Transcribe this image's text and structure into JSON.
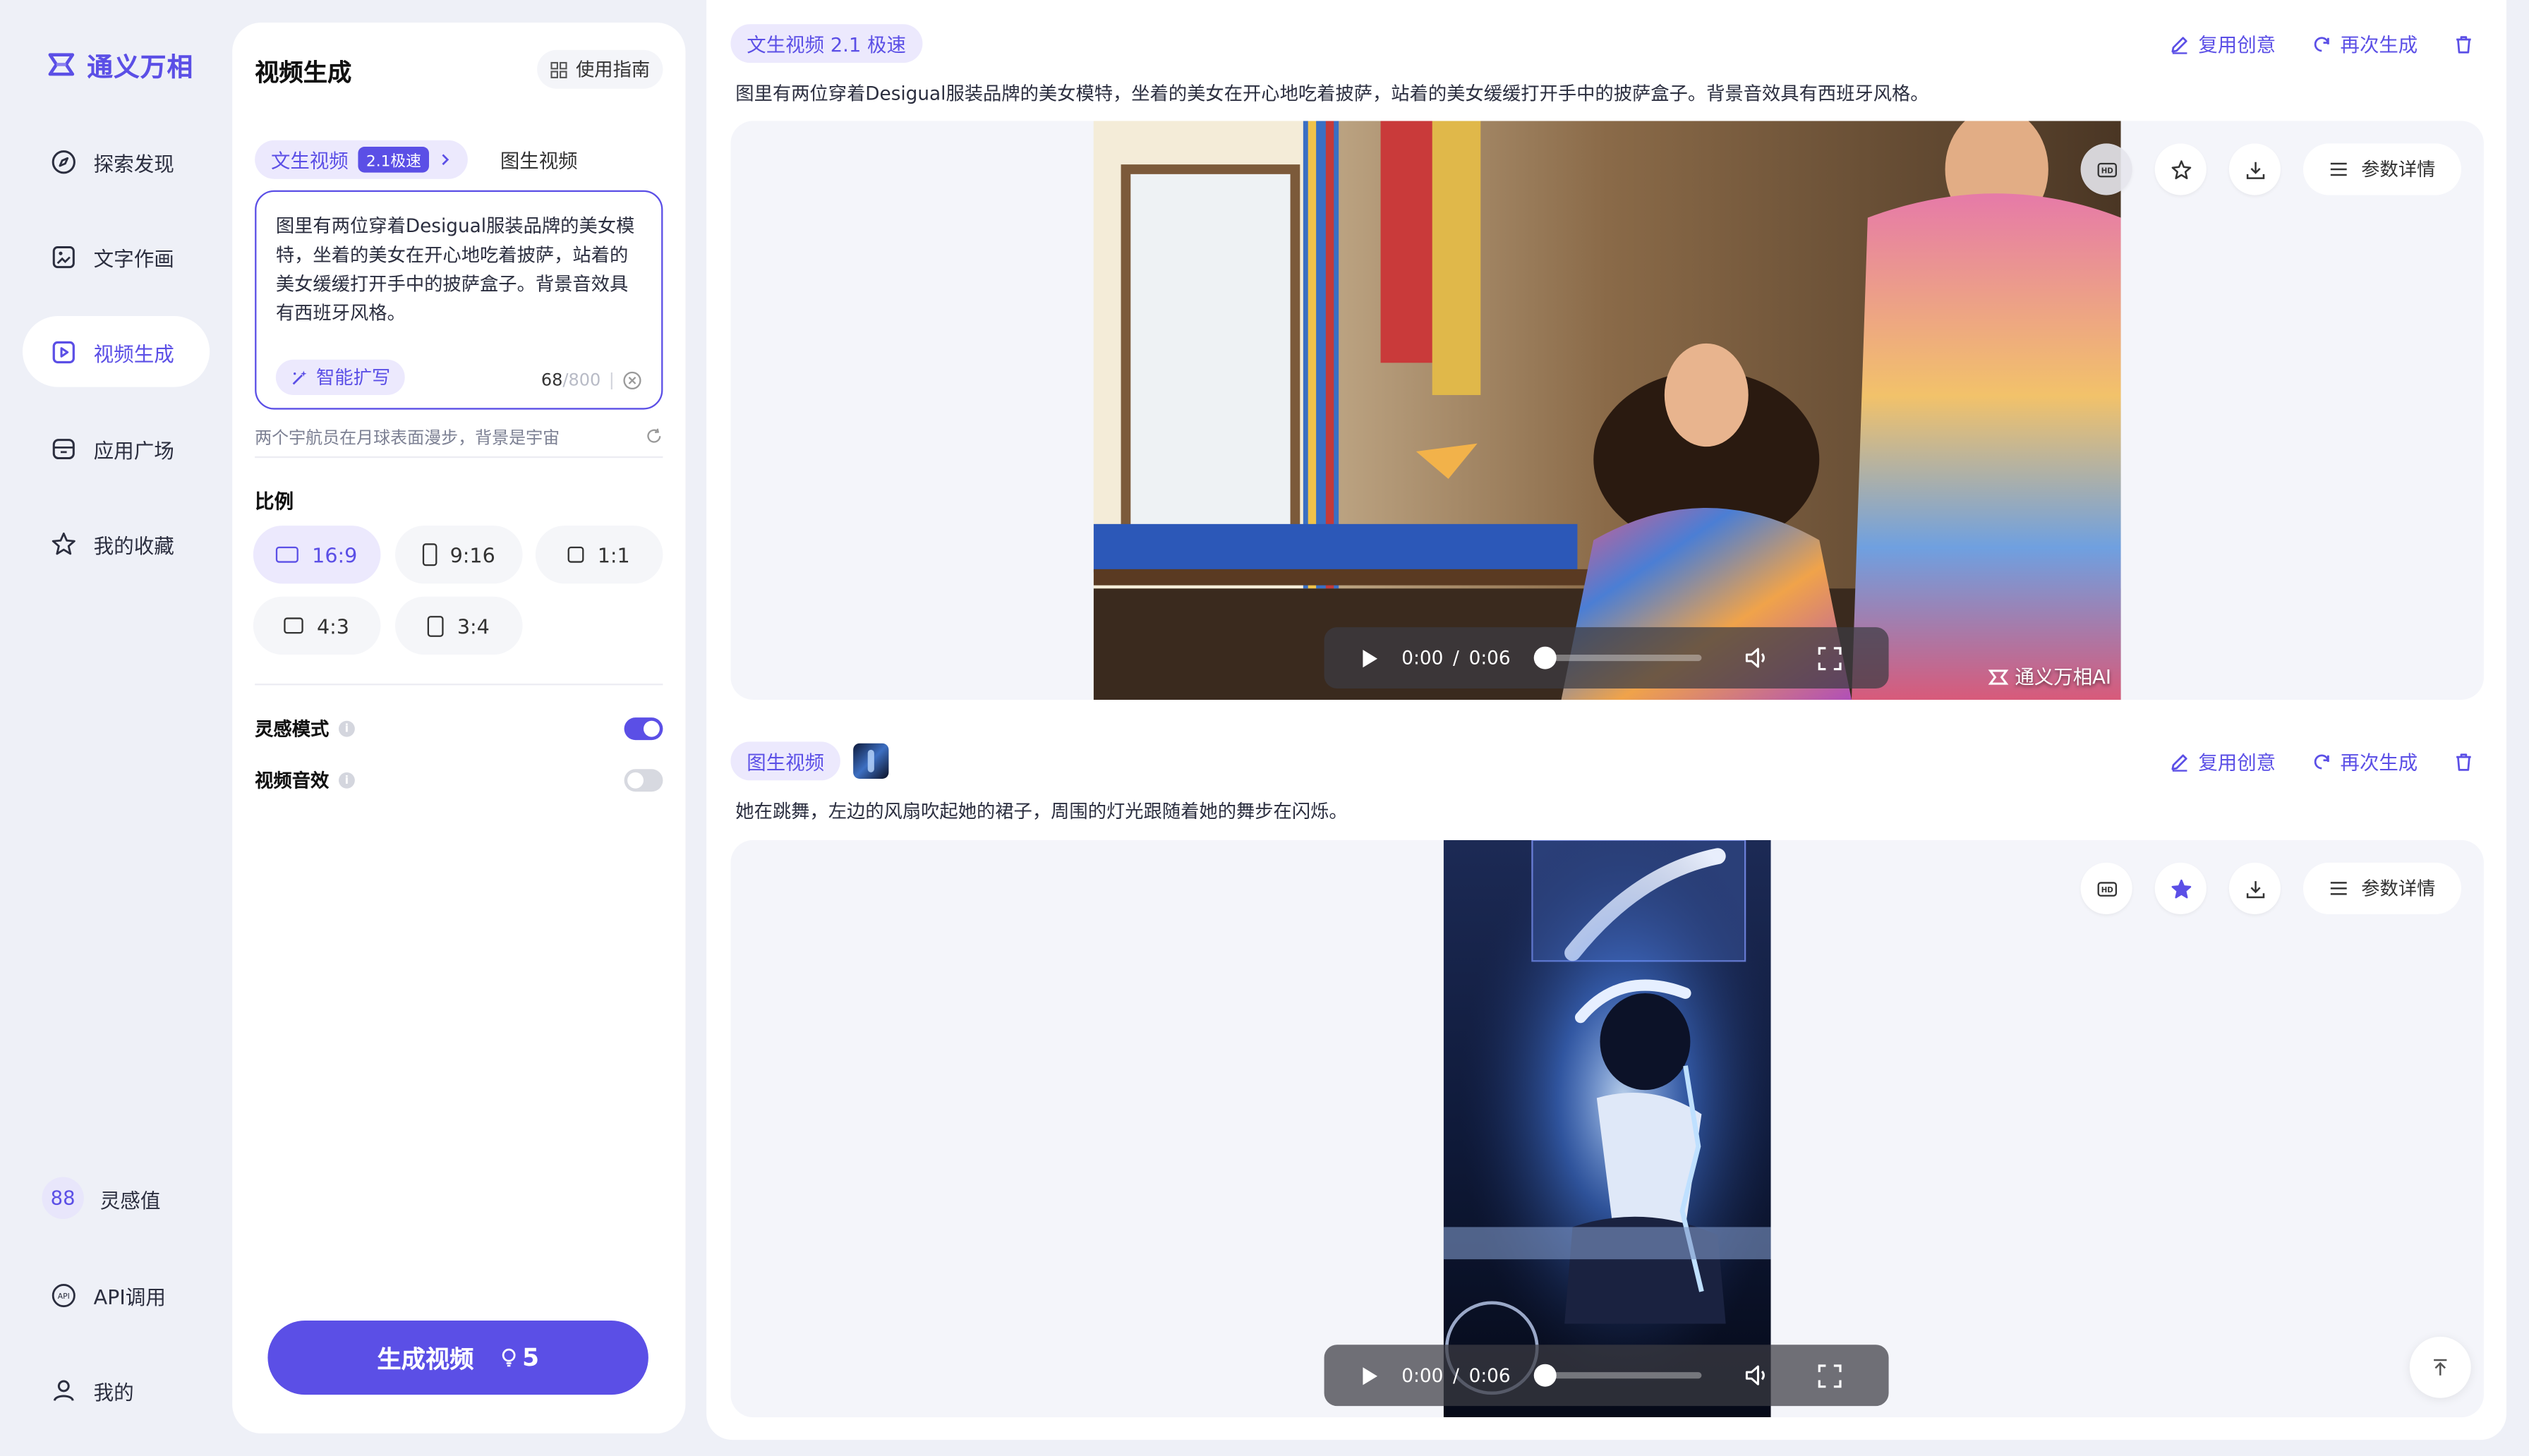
{
  "brand": {
    "name": "通义万相",
    "accent": "#5b4fe6"
  },
  "nav": {
    "items": [
      {
        "label": "探索发现",
        "icon": "compass-icon"
      },
      {
        "label": "文字作画",
        "icon": "image-edit-icon"
      },
      {
        "label": "视频生成",
        "icon": "video-icon",
        "active": true
      },
      {
        "label": "应用广场",
        "icon": "app-store-icon"
      },
      {
        "label": "我的收藏",
        "icon": "star-icon"
      }
    ],
    "bottom": {
      "points_value": "88",
      "points_label": "灵感值",
      "api_label": "API调用",
      "profile_label": "我的"
    }
  },
  "panel": {
    "title": "视频生成",
    "guide_label": "使用指南",
    "tabs": [
      {
        "label": "文生视频",
        "badge": "2.1极速",
        "active": true
      },
      {
        "label": "图生视频"
      }
    ],
    "prompt": {
      "value": "图里有两位穿着Desigual服装品牌的美女模特，坐着的美女在开心地吃着披萨，站着的美女缓缓打开手中的披萨盒子。背景音效具有西班牙风格。",
      "expand_label": "智能扩写",
      "count": "68",
      "max": "/800",
      "sep": "|"
    },
    "hint": "两个宇航员在月球表面漫步，背景是宇宙",
    "ratio_label": "比例",
    "ratios": [
      {
        "label": "16:9",
        "active": true
      },
      {
        "label": "9:16"
      },
      {
        "label": "1:1"
      },
      {
        "label": "4:3"
      },
      {
        "label": "3:4"
      }
    ],
    "toggles": [
      {
        "label": "灵感模式",
        "on": true
      },
      {
        "label": "视频音效",
        "on": false
      }
    ],
    "generate_label": "生成视频",
    "generate_cost": "5"
  },
  "cards": [
    {
      "tag": "文生视频 2.1 极速",
      "prompt": "图里有两位穿着Desigual服装品牌的美女模特，坐着的美女在开心地吃着披萨，站着的美女缓缓打开手中的披萨盒子。背景音效具有西班牙风格。",
      "actions": {
        "reuse": "复用创意",
        "regen": "再次生成"
      },
      "params_label": "参数详情",
      "time_current": "0:00",
      "time_sep": "/",
      "time_total": "0:06",
      "watermark": "通义万相AI",
      "favorited": false
    },
    {
      "tag": "图生视频",
      "prompt": "她在跳舞，左边的风扇吹起她的裙子，周围的灯光跟随着她的舞步在闪烁。",
      "actions": {
        "reuse": "复用创意",
        "regen": "再次生成"
      },
      "params_label": "参数详情",
      "time_current": "0:00",
      "time_sep": "/",
      "time_total": "0:06",
      "favorited": true
    }
  ]
}
